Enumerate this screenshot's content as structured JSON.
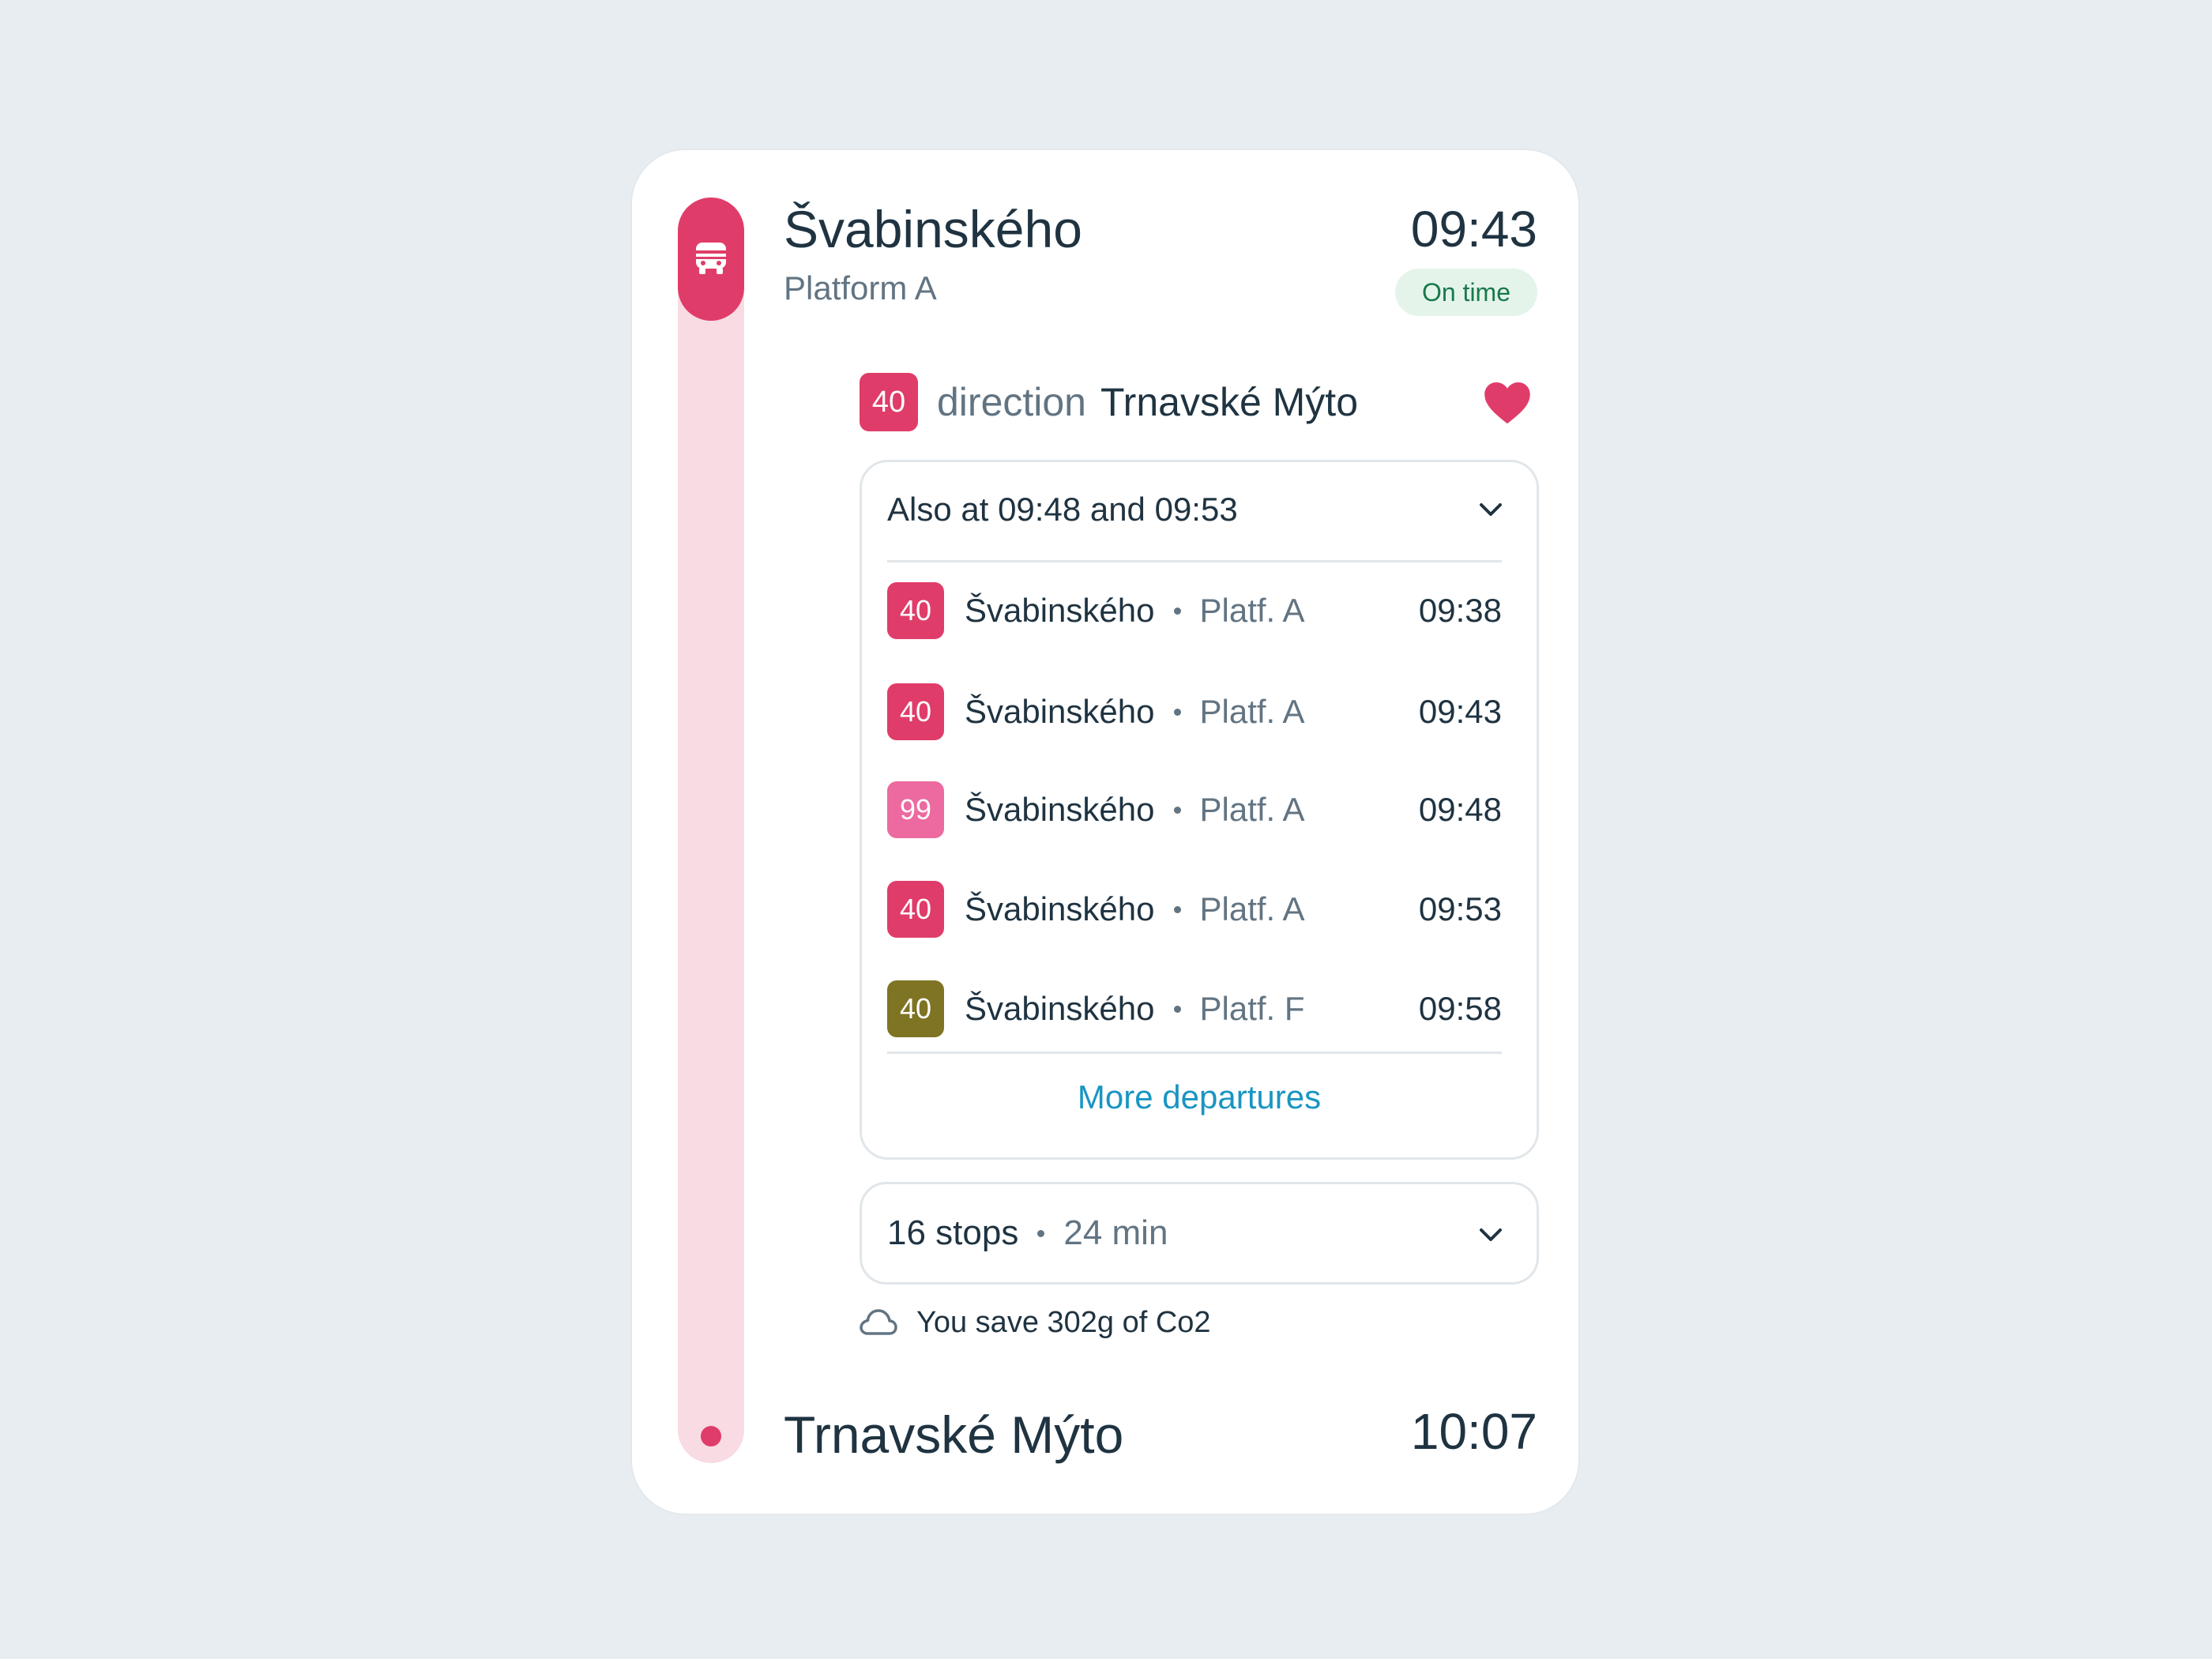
{
  "origin": {
    "name": "Švabinského",
    "platform": "Platform A",
    "time": "09:43",
    "status": "On time",
    "icon": "bus-icon"
  },
  "route": {
    "line": "40",
    "direction_word": "direction",
    "destination": "Trnavské Mýto",
    "favorite_icon": "heart-icon"
  },
  "departures": {
    "header": "Also at 09:48 and 09:53",
    "rows": [
      {
        "line": "40",
        "stop": "Švabinského",
        "platform": "Platf. A",
        "time": "09:38",
        "color": "#e03c69"
      },
      {
        "line": "40",
        "stop": "Švabinského",
        "platform": "Platf. A",
        "time": "09:43",
        "color": "#e03c69"
      },
      {
        "line": "99",
        "stop": "Švabinského",
        "platform": "Platf. A",
        "time": "09:48",
        "color": "#ec6aa0"
      },
      {
        "line": "40",
        "stop": "Švabinského",
        "platform": "Platf. A",
        "time": "09:53",
        "color": "#e03c69"
      },
      {
        "line": "40",
        "stop": "Švabinského",
        "platform": "Platf. F",
        "time": "09:58",
        "color": "#7e7423"
      }
    ],
    "more_label": "More departures"
  },
  "stops": {
    "count": "16 stops",
    "duration": "24 min"
  },
  "co2": {
    "text": "You save 302g of Co2",
    "icon": "cloud-icon"
  },
  "destination": {
    "name": "Trnavské Mýto",
    "time": "10:07"
  },
  "colors": {
    "accent": "#e03c69",
    "rail": "#f8dbe3",
    "status_bg": "#e4f4eb",
    "status_text": "#18794a",
    "link": "#1995c2"
  }
}
